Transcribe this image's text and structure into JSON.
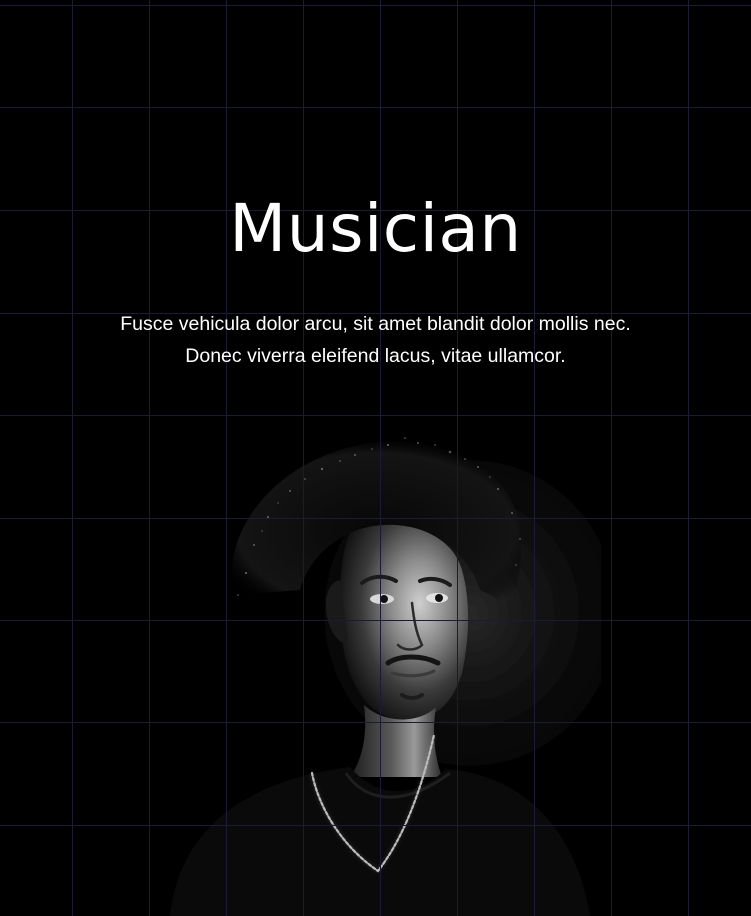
{
  "hero": {
    "title": "Musician",
    "subtitle_line1": "Fusce vehicula dolor arcu, sit amet blandit dolor mollis nec.",
    "subtitle_line2": "Donec viverra eleifend lacus, vitae ullamcor."
  },
  "theme": {
    "background": "#000000",
    "text": "#ffffff",
    "grid_line": "#1b1b33"
  }
}
